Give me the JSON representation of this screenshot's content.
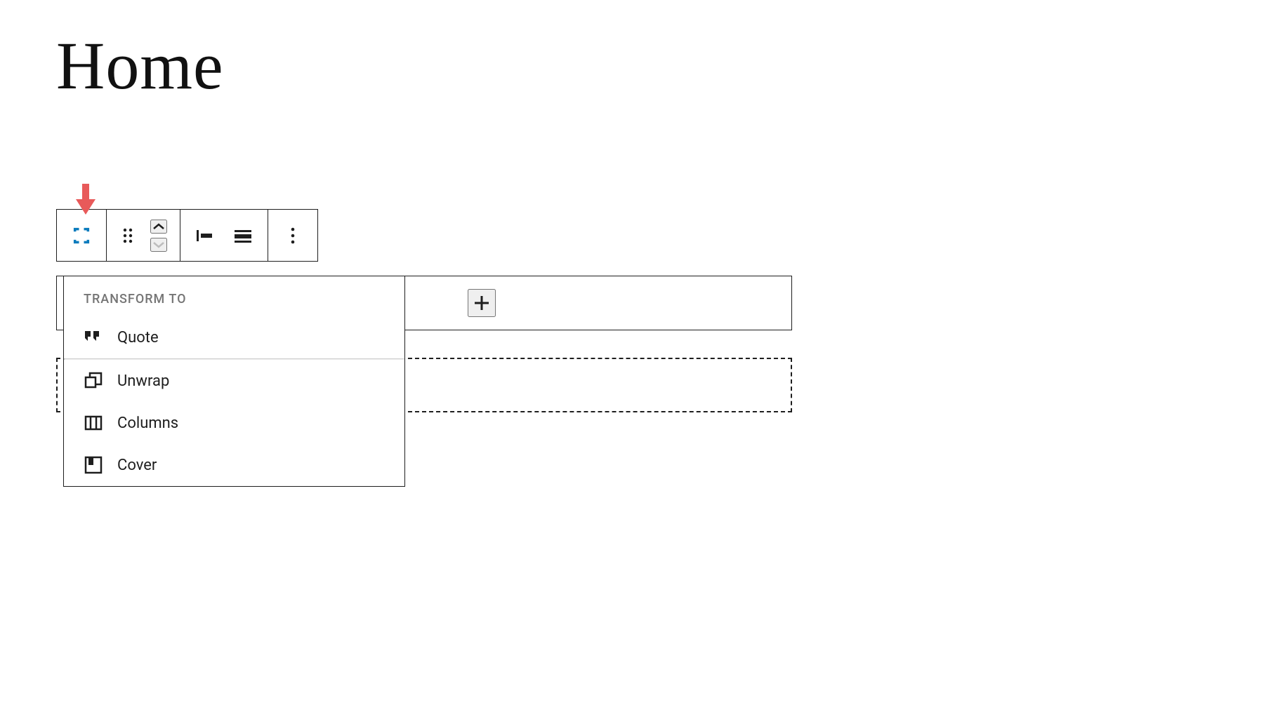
{
  "page": {
    "title": "Home"
  },
  "colors": {
    "accent": "#0a7bbd",
    "indicator": "#e85a5a",
    "text": "#1e1e1e",
    "muted": "#757575"
  },
  "dropdown": {
    "header": "TRANSFORM TO",
    "section1": [
      {
        "label": "Quote",
        "icon": "quote-icon"
      }
    ],
    "section2": [
      {
        "label": "Unwrap",
        "icon": "unwrap-icon"
      },
      {
        "label": "Columns",
        "icon": "columns-icon"
      },
      {
        "label": "Cover",
        "icon": "cover-icon"
      }
    ]
  },
  "toolbar": {
    "block_type": "separator",
    "drag": "drag",
    "move_up": "up",
    "move_down": "down",
    "align_left": "align-left",
    "align_wide": "align-wide",
    "more": "more"
  }
}
